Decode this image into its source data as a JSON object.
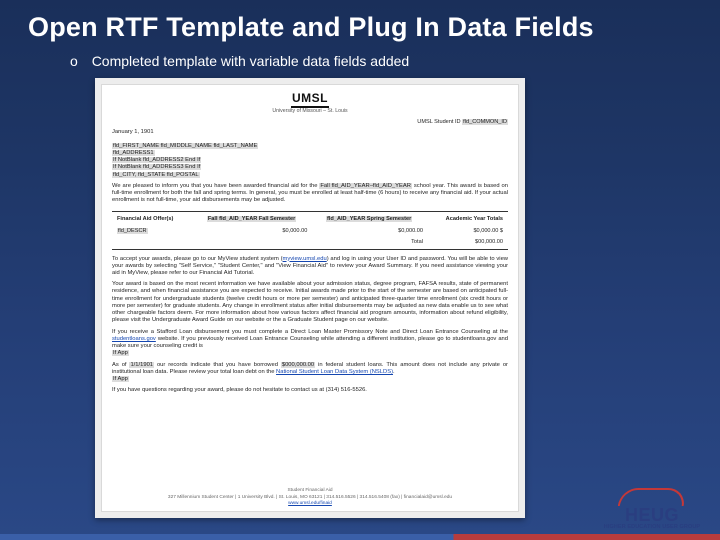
{
  "slide": {
    "title": "Open RTF Template and Plug In Data Fields",
    "bullet_glyph": "o",
    "bullet_text": "Completed template with variable data fields added"
  },
  "doc": {
    "logo_text": "UMSL",
    "subtitle": "University of Missouri – St. Louis",
    "id_label": "UMSL Student ID",
    "id_value": "fld_COMMON_ID",
    "date": "January 1, 1901",
    "addr_name": "fld_FIRST_NAME fld_MIDDLE_NAME fld_LAST_NAME",
    "addr_line1a": "fld_ADDRESS1",
    "addr_line2": "If NotBlank  fld_ADDRESS2  End If",
    "addr_line3": "If NotBlank  fld_ADDRESS3 End If",
    "addr_city": "fld_CITY, fld_STATE fld_POSTAL",
    "p1_a": "We are pleased to inform you that you have been awarded financial aid for the ",
    "p1_year": "Fall fld_AID_YEAR–fld_AID_YEAR",
    "p1_b": " school year. This award is based on full-time enrollment for both the fall and spring terms. In general, you must be enrolled at least half-time (6 hours) to receive any financial aid. If your actual enrollment is not full-time, your aid disbursements may be adjusted.",
    "fin": {
      "h1": "Financial Aid Offer(s)",
      "h2": "Fall fld_AID_YEAR\nFall Semester",
      "h3": "fld_AID_YEAR\nSpring Semester",
      "h4": "Academic Year Totals",
      "row_label": "fld_DESCR",
      "c1": "$0,000.00",
      "c2": "$0,000.00",
      "c3": "$0,000.00 $",
      "total_label": "Total",
      "total_val": "$00,000.00"
    },
    "p2_a": "To accept your awards, please go to our MyView student system (",
    "p2_link": "myview.umsl.edu",
    "p2_b": ") and log in using your User ID and password. You will be able to view your awards by selecting \"Self Service,\" \"Student Center,\" and \"View Financial Aid\" to review your Award Summary. If you need assistance viewing your aid in MyView, please refer to our Financial Aid Tutorial.",
    "p3": "Your award is based on the most recent information we have available about your admission status, degree program, FAFSA results, state of permanent residence, and when financial assistance you are expected to receive. Initial awards made prior to the start of the semester are based on anticipated full-time enrollment for undergraduate students (twelve credit hours or more per semester) and anticipated three-quarter time enrollment (six credit hours or more per semester) for graduate students. Any change in enrollment status after initial disbursements may be adjusted as new data enable us to see what other chargeable factors deem. For more information about how various factors affect financial aid program amounts, information about refund eligibility, please visit the Undergraduate Award Guide on our website or the a Graduate Student page on our website.",
    "p4_a": "If you receive a Stafford Loan disbursement you must complete a Direct Loan Master Promissory Note and Direct Loan Entrance Counseling at the ",
    "p4_link": "studentloans.gov",
    "p4_b": " website. If you previously received Loan Entrance Counseling while attending a different institution, please go to studentloans.gov and make sure your counseling credit is ",
    "p4_c": "If App",
    "p5_a": "As of ",
    "p5_date": "1/1/1901",
    "p5_b": " our records indicate that you have borrowed ",
    "p5_amt": "$000,000.00",
    "p5_c": " in federal student loans. This amount does not include any private or institutional loan data. Please review your total loan debt on the ",
    "p5_link": "National Student Loan Data System (NSLDS)",
    "p5_d": ".",
    "p5_e": "If App",
    "p6": "If you have questions regarding your award, please do not hesitate to contact us at (314) 516-5526.",
    "footer1": "Student Financial Aid",
    "footer2": "327 Millennium Student Center  |  1 University Blvd.  |  St. Louis, MO 63121  |  314.516.5526  |  314.516.5408 (fax)  |  financialaid@umsl.edu",
    "footer3": "www.umsl.edu/finaid"
  },
  "logo": {
    "brand": "HEUG",
    "tagline": "HIGHER EDUCATION USER GROUP"
  }
}
